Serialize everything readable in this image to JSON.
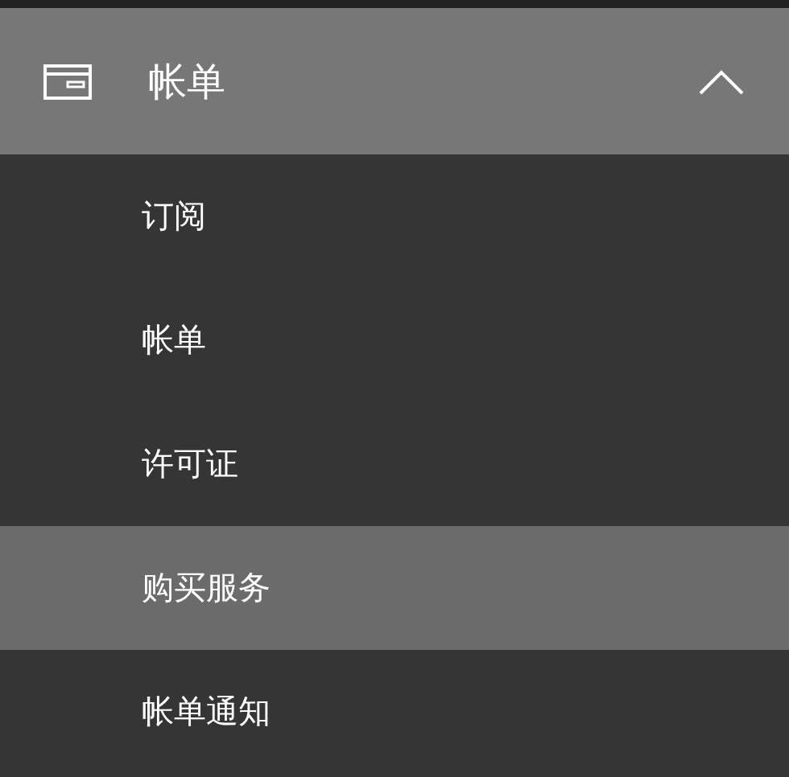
{
  "header": {
    "label": "帐单",
    "expanded": true
  },
  "items": [
    {
      "label": "订阅",
      "selected": false
    },
    {
      "label": "帐单",
      "selected": false
    },
    {
      "label": "许可证",
      "selected": false
    },
    {
      "label": "购买服务",
      "selected": true
    },
    {
      "label": "帐单通知",
      "selected": false
    }
  ]
}
